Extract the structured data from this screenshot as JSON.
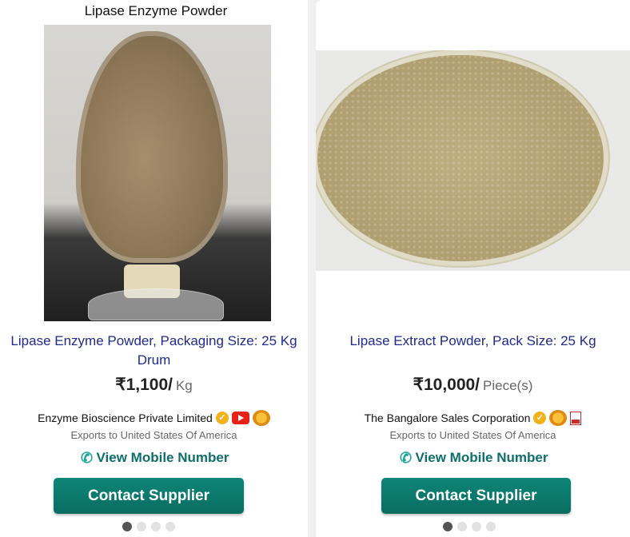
{
  "cards": [
    {
      "image_caption": "Lipase Enzyme Powder",
      "title": "Lipase Enzyme Powder, Packaging Size: 25 Kg Drum",
      "price": "₹1,100/",
      "unit": "Kg",
      "supplier": "Enzyme Bioscience Private Limited",
      "exports": "Exports to United States Of America",
      "mobile_label": "View Mobile Number",
      "contact_label": "Contact Supplier"
    },
    {
      "title": "Lipase Extract Powder, Pack Size: 25 Kg",
      "price": "₹10,000/",
      "unit": "Piece(s)",
      "supplier": "The Bangalore Sales Corporation",
      "exports": "Exports to United States Of America",
      "mobile_label": "View Mobile Number",
      "contact_label": "Contact Supplier"
    }
  ],
  "colors": {
    "title": "#1f2a8c",
    "accent": "#0e6f6a",
    "button": "#0a6d63"
  },
  "icons": [
    "verified-badge-icon",
    "youtube-icon",
    "trust-seal-icon",
    "pdf-icon",
    "phone-icon"
  ]
}
